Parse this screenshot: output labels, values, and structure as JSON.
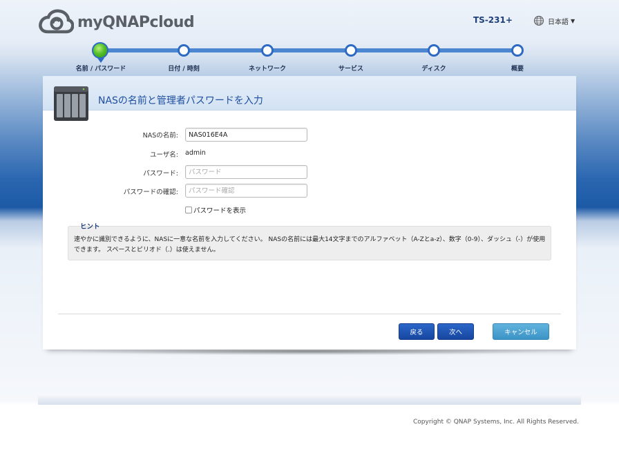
{
  "header": {
    "brand": "myQNAPcloud",
    "model": "TS-231+",
    "language": "日本語"
  },
  "steps": [
    {
      "label": "名前 / パスワード",
      "active": true
    },
    {
      "label": "日付 / 時刻",
      "active": false
    },
    {
      "label": "ネットワーク",
      "active": false
    },
    {
      "label": "サービス",
      "active": false
    },
    {
      "label": "ディスク",
      "active": false
    },
    {
      "label": "概要",
      "active": false
    }
  ],
  "panel": {
    "title": "NASの名前と管理者パスワードを入力",
    "nas_name_label": "NASの名前:",
    "nas_name_value": "NAS016E4A",
    "user_label": "ユーザ名:",
    "user_value": "admin",
    "password_label": "パスワード:",
    "password_placeholder": "パスワード",
    "confirm_label": "パスワードの確認:",
    "confirm_placeholder": "パスワード確認",
    "show_password_label": "パスワードを表示",
    "show_password_checked": false,
    "hint_title": "ヒント",
    "hint_text": "速やかに識別できるように、NASに一意な名前を入力してください。 NASの名前には最大14文字までのアルファベット（A-Zとa-z）、数字（0-9）、ダッシュ（-）が使用できます。 スペースとピリオド（.）は使えません。"
  },
  "buttons": {
    "back": "戻る",
    "next": "次へ",
    "cancel": "キャンセル"
  },
  "footer": {
    "copyright": "Copyright © QNAP Systems, Inc. All Rights Reserved."
  },
  "colors": {
    "accent": "#2d6ac2",
    "title": "#1e4fa0",
    "active_step": "#56c02a",
    "cancel": "#4aa3d3"
  }
}
